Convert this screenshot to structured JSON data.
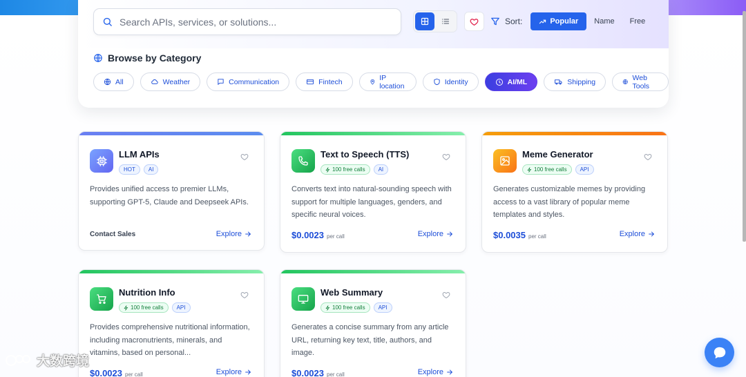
{
  "search": {
    "placeholder": "Search APIs, services, or solutions..."
  },
  "sort": {
    "label": "Sort:",
    "options": [
      "Popular",
      "Name",
      "Free"
    ],
    "active": "Popular"
  },
  "browse": {
    "title": "Browse by Category",
    "categories": [
      "All",
      "Weather",
      "Communication",
      "Fintech",
      "IP location",
      "Identity",
      "AI/ML",
      "Shipping",
      "Web Tools"
    ],
    "active_category": "AI/ML"
  },
  "cards": [
    {
      "title": "LLM APIs",
      "badges": [
        "HOT",
        "AI"
      ],
      "description": "Provides unified access to premier LLMs, supporting GPT-5, Claude and Deepseek APIs.",
      "contact": "Contact Sales",
      "explore": "Explore",
      "accent_color": "#6f84f4",
      "icon": "cpu-icon"
    },
    {
      "title": "Text to Speech (TTS)",
      "badges": [
        "100 free calls",
        "AI"
      ],
      "description": "Converts text into natural-sounding speech with support for multiple languages, genders, and specific neural voices.",
      "price": "$0.0023",
      "per": "per call",
      "explore": "Explore",
      "accent_color": "#4ade80",
      "icon": "phone-icon"
    },
    {
      "title": "Meme Generator",
      "badges": [
        "100 free calls",
        "API"
      ],
      "description": "Generates customizable memes by providing access to a vast library of popular meme templates and styles.",
      "price": "$0.0035",
      "per": "per call",
      "explore": "Explore",
      "accent_color": "#f59e0b",
      "icon": "image-icon"
    },
    {
      "title": "Nutrition Info",
      "badges": [
        "100 free calls",
        "API"
      ],
      "description": "Provides comprehensive nutritional information, including macronutrients, minerals, and vitamins, based on personal...",
      "price": "$0.0023",
      "per": "per call",
      "explore": "Explore",
      "accent_color": "#4ade80",
      "icon": "cart-icon"
    },
    {
      "title": "Web Summary",
      "badges": [
        "100 free calls",
        "API"
      ],
      "description": "Generates a concise summary from any article URL, returning key text, title, authors, and image.",
      "price": "$0.0023",
      "per": "per call",
      "explore": "Explore",
      "accent_color": "#4ade80",
      "icon": "monitor-icon"
    }
  ],
  "watermark": {
    "text": "大数跨境"
  },
  "colors": {
    "primary": "#2563eb",
    "active_category": "#4f46e5",
    "free_badge": "#15803d"
  }
}
